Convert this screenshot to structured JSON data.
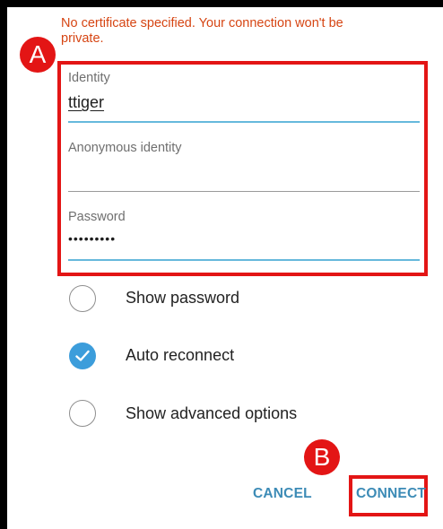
{
  "warning": {
    "text": "No certificate specified. Your connection won't be private."
  },
  "badges": {
    "a": "A",
    "b": "B"
  },
  "fields": {
    "identity": {
      "label": "Identity",
      "value": "ttiger"
    },
    "anonymous_identity": {
      "label": "Anonymous identity",
      "value": ""
    },
    "password": {
      "label": "Password",
      "value": "•••••••••"
    }
  },
  "options": {
    "show_password": {
      "label": "Show password",
      "checked": false
    },
    "auto_reconnect": {
      "label": "Auto reconnect",
      "checked": true
    },
    "show_advanced": {
      "label": "Show advanced options",
      "checked": false
    }
  },
  "buttons": {
    "cancel": "CANCEL",
    "connect": "CONNECT"
  },
  "colors": {
    "warning": "#d64513",
    "annotation_red": "#e31515",
    "accent": "#3c9ddb",
    "button_text": "#3c8bb6"
  },
  "icons": {
    "check": "check-icon"
  }
}
